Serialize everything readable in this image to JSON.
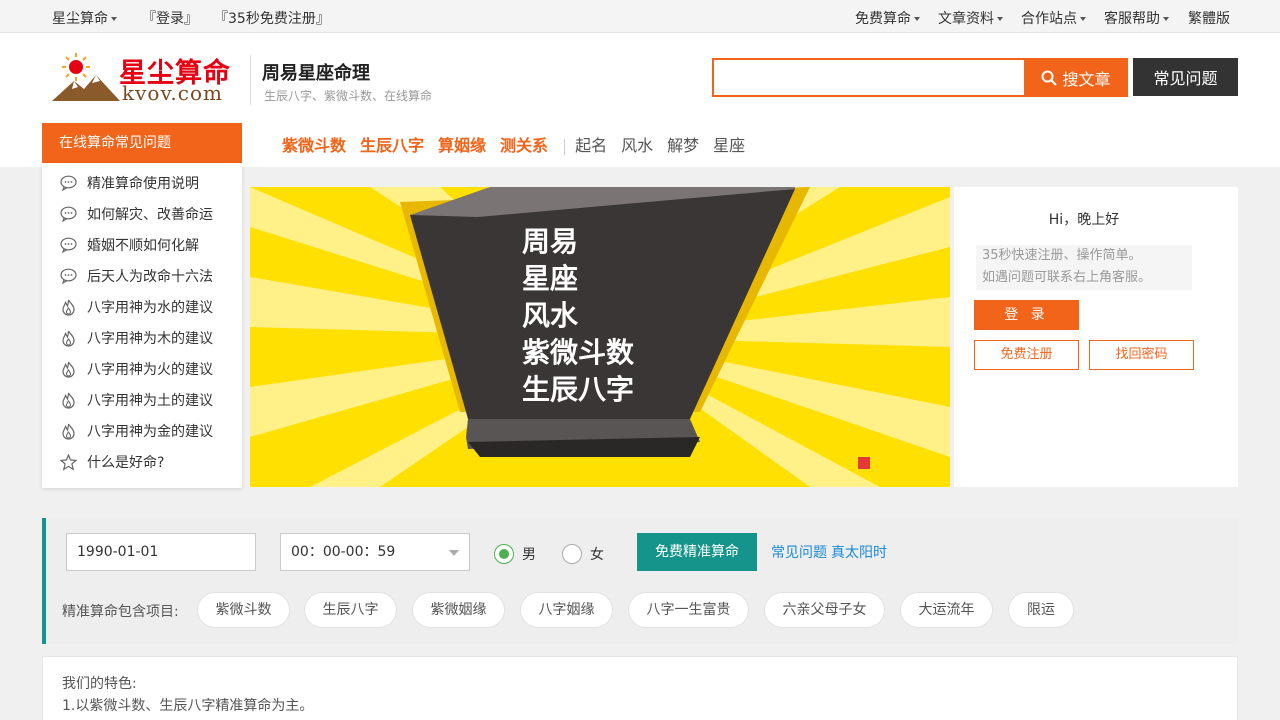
{
  "topbar": {
    "left": [
      {
        "label": "星尘算命",
        "dropdown": true
      },
      {
        "label": "『登录』",
        "dropdown": false
      },
      {
        "label": "『35秒免费注册』",
        "dropdown": false
      }
    ],
    "right": [
      {
        "label": "免费算命",
        "dropdown": true
      },
      {
        "label": "文章资料",
        "dropdown": true
      },
      {
        "label": "合作站点",
        "dropdown": true
      },
      {
        "label": "客服帮助",
        "dropdown": true
      },
      {
        "label": "繁體版",
        "dropdown": false
      }
    ]
  },
  "logo": {
    "cn": "星尘算命",
    "en": "kvov.com"
  },
  "site": {
    "title": "周易星座命理",
    "subtitle": "生辰八字、紫微斗数、在线算命"
  },
  "search": {
    "value": "",
    "button_label": "搜文章",
    "faq_label": "常见问题"
  },
  "nav": {
    "left_title": "在线算命常见问题",
    "hot": [
      "紫微斗数",
      "生辰八字",
      "算姻缘",
      "测关系"
    ],
    "plain": [
      "起名",
      "风水",
      "解梦",
      "星座"
    ]
  },
  "sidemenu": [
    {
      "label": "精准算命使用说明",
      "icon": "chat-bubble-icon"
    },
    {
      "label": "如何解灾、改善命运",
      "icon": "chat-bubble-icon"
    },
    {
      "label": "婚姻不顺如何化解",
      "icon": "chat-bubble-icon"
    },
    {
      "label": "后天人为改命十六法",
      "icon": "chat-bubble-icon"
    },
    {
      "label": "八字用神为水的建议",
      "icon": "flame-icon"
    },
    {
      "label": "八字用神为木的建议",
      "icon": "flame-icon"
    },
    {
      "label": "八字用神为火的建议",
      "icon": "flame-icon"
    },
    {
      "label": "八字用神为土的建议",
      "icon": "flame-icon"
    },
    {
      "label": "八字用神为金的建议",
      "icon": "flame-icon"
    },
    {
      "label": "什么是好命?",
      "icon": "star-icon"
    }
  ],
  "banner": {
    "lines": [
      "周易",
      "星座",
      "风水",
      "紫微斗数",
      "生辰八字"
    ]
  },
  "login": {
    "greeting": "Hi，晚上好",
    "note_line1": "35秒快速注册、操作简单。",
    "note_line2": "如遇问题可联系右上角客服。",
    "login_label": "登 录",
    "register_label": "免费注册",
    "recover_label": "找回密码"
  },
  "form": {
    "date_value": "1990-01-01",
    "time_value": "00：00-00：59",
    "gender_male": "男",
    "gender_female": "女",
    "selected_gender": "男",
    "submit_label": "免费精准算命",
    "link1": "常见问题",
    "link2": "真太阳时",
    "includes_label": "精准算命包含项目:",
    "chips": [
      "紫微斗数",
      "生辰八字",
      "紫微姻缘",
      "八字姻缘",
      "八字一生富贵",
      "六亲父母子女",
      "大运流年",
      "限运"
    ]
  },
  "features": {
    "heading": "我们的特色:",
    "line1": "1.以紫微斗数、生辰八字精准算命为主。"
  },
  "colors": {
    "accent": "#f26419",
    "teal": "#14948a",
    "banner": "#ffe000",
    "link": "#1a8ad4"
  }
}
